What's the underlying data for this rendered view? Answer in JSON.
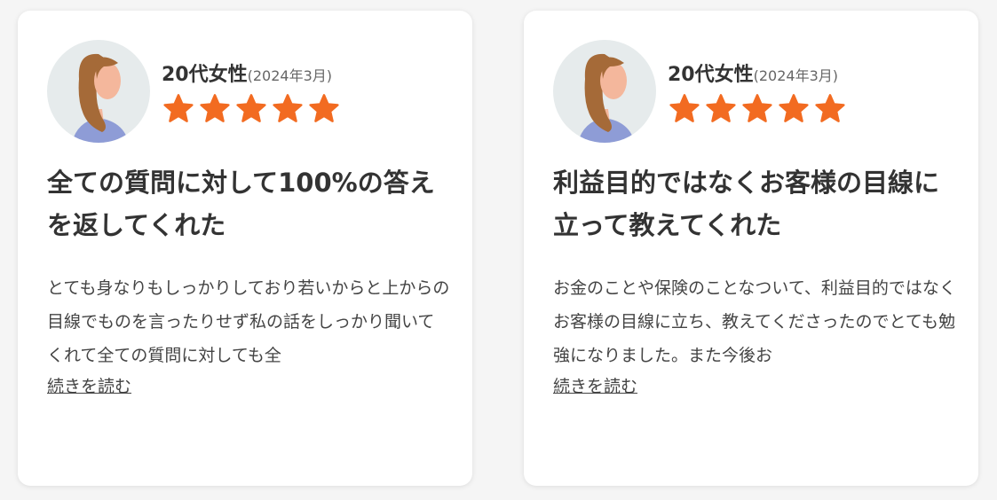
{
  "reviews": [
    {
      "reviewer": "20代女性",
      "date": "(2024年3月)",
      "rating": 5,
      "title": "全ての質問に対して100%の答えを返してくれた",
      "body": "とても身なりもしっかりしており若いからと上からの目線でものを言ったりせず私の話をしっかり聞いてくれて全ての質問に対しても全",
      "read_more": "続きを読む"
    },
    {
      "reviewer": "20代女性",
      "date": "(2024年3月)",
      "rating": 5,
      "title": "利益目的ではなくお客様の目線に立って教えてくれた",
      "body": "お金のことや保険のことなついて、利益目的ではなくお客様の目線に立ち、教えてくださったのでとても勉強になりました。また今後お",
      "read_more": "続きを読む"
    }
  ],
  "colors": {
    "star": "#f26b21",
    "card_bg": "#ffffff",
    "avatar_bg": "#e6ebec",
    "hair": "#a56a38",
    "skin": "#f4b79c",
    "shirt": "#8e9cd6"
  },
  "icons": {
    "avatar": "woman-avatar-icon",
    "star": "star-icon"
  }
}
